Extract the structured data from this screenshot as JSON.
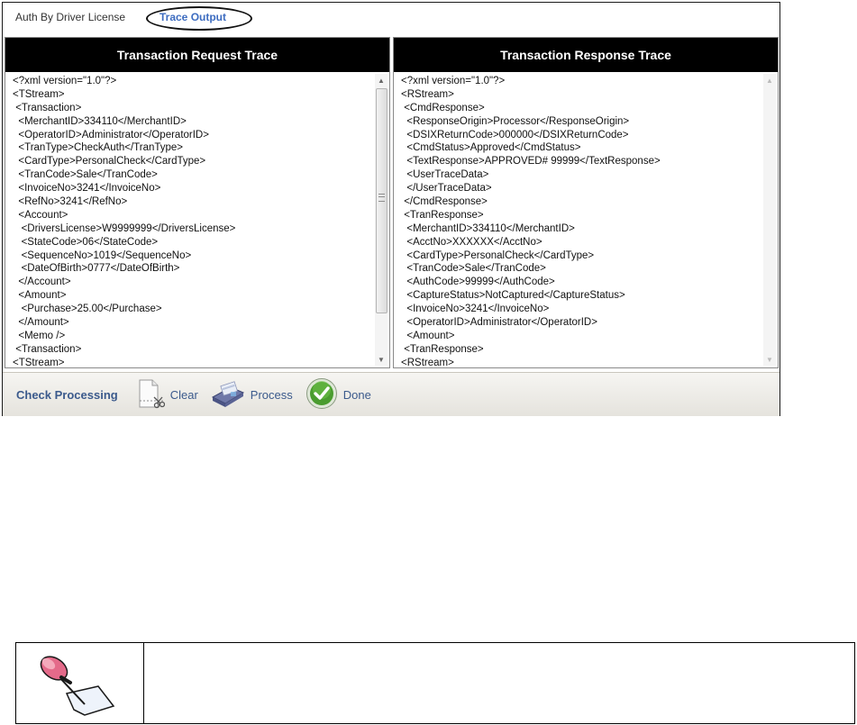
{
  "tabs": [
    {
      "label": "Auth By Driver License",
      "active": false
    },
    {
      "label": "Trace Output",
      "active": true
    }
  ],
  "request_pane": {
    "title": "Transaction Request Trace",
    "lines": [
      "<?xml version=\"1.0\"?>",
      "<TStream>",
      " <Transaction>",
      "  <MerchantID>334110</MerchantID>",
      "  <OperatorID>Administrator</OperatorID>",
      "  <TranType>CheckAuth</TranType>",
      "  <CardType>PersonalCheck</CardType>",
      "  <TranCode>Sale</TranCode>",
      "  <InvoiceNo>3241</InvoiceNo>",
      "  <RefNo>3241</RefNo>",
      "  <Account>",
      "   <DriversLicense>W9999999</DriversLicense>",
      "   <StateCode>06</StateCode>",
      "   <SequenceNo>1019</SequenceNo>",
      "   <DateOfBirth>0777</DateOfBirth>",
      "  </Account>",
      "  <Amount>",
      "   <Purchase>25.00</Purchase>",
      "  </Amount>",
      "  <Memo />",
      " <Transaction>",
      "<TStream>"
    ]
  },
  "response_pane": {
    "title": "Transaction Response Trace",
    "lines": [
      "<?xml version=\"1.0\"?>",
      "<RStream>",
      " <CmdResponse>",
      "  <ResponseOrigin>Processor</ResponseOrigin>",
      "  <DSIXReturnCode>000000</DSIXReturnCode>",
      "  <CmdStatus>Approved</CmdStatus>",
      "  <TextResponse>APPROVED# 99999</TextResponse>",
      "  <UserTraceData>",
      "  </UserTraceData>",
      " </CmdResponse>",
      " <TranResponse>",
      "  <MerchantID>334110</MerchantID>",
      "  <AcctNo>XXXXXX</AcctNo>",
      "  <CardType>PersonalCheck</CardType>",
      "  <TranCode>Sale</TranCode>",
      "  <AuthCode>99999</AuthCode>",
      "  <CaptureStatus>NotCaptured</CaptureStatus>",
      "  <InvoiceNo>3241</InvoiceNo>",
      "  <OperatorID>Administrator</OperatorID>",
      "  <Amount>",
      " <TranResponse>",
      "<RStream>"
    ]
  },
  "toolbar": {
    "title": "Check Processing",
    "clear_label": "Clear",
    "process_label": "Process",
    "done_label": "Done"
  },
  "icons": {
    "clear": "scissors-document-icon",
    "process": "credit-card-reader-icon",
    "done": "green-check-icon",
    "note": "pushpin-note-icon"
  },
  "colors": {
    "header_bg": "#000000",
    "accent_text": "#3b5a8c",
    "active_tab": "#3d6cc0",
    "done_green": "#4a9c2f"
  }
}
